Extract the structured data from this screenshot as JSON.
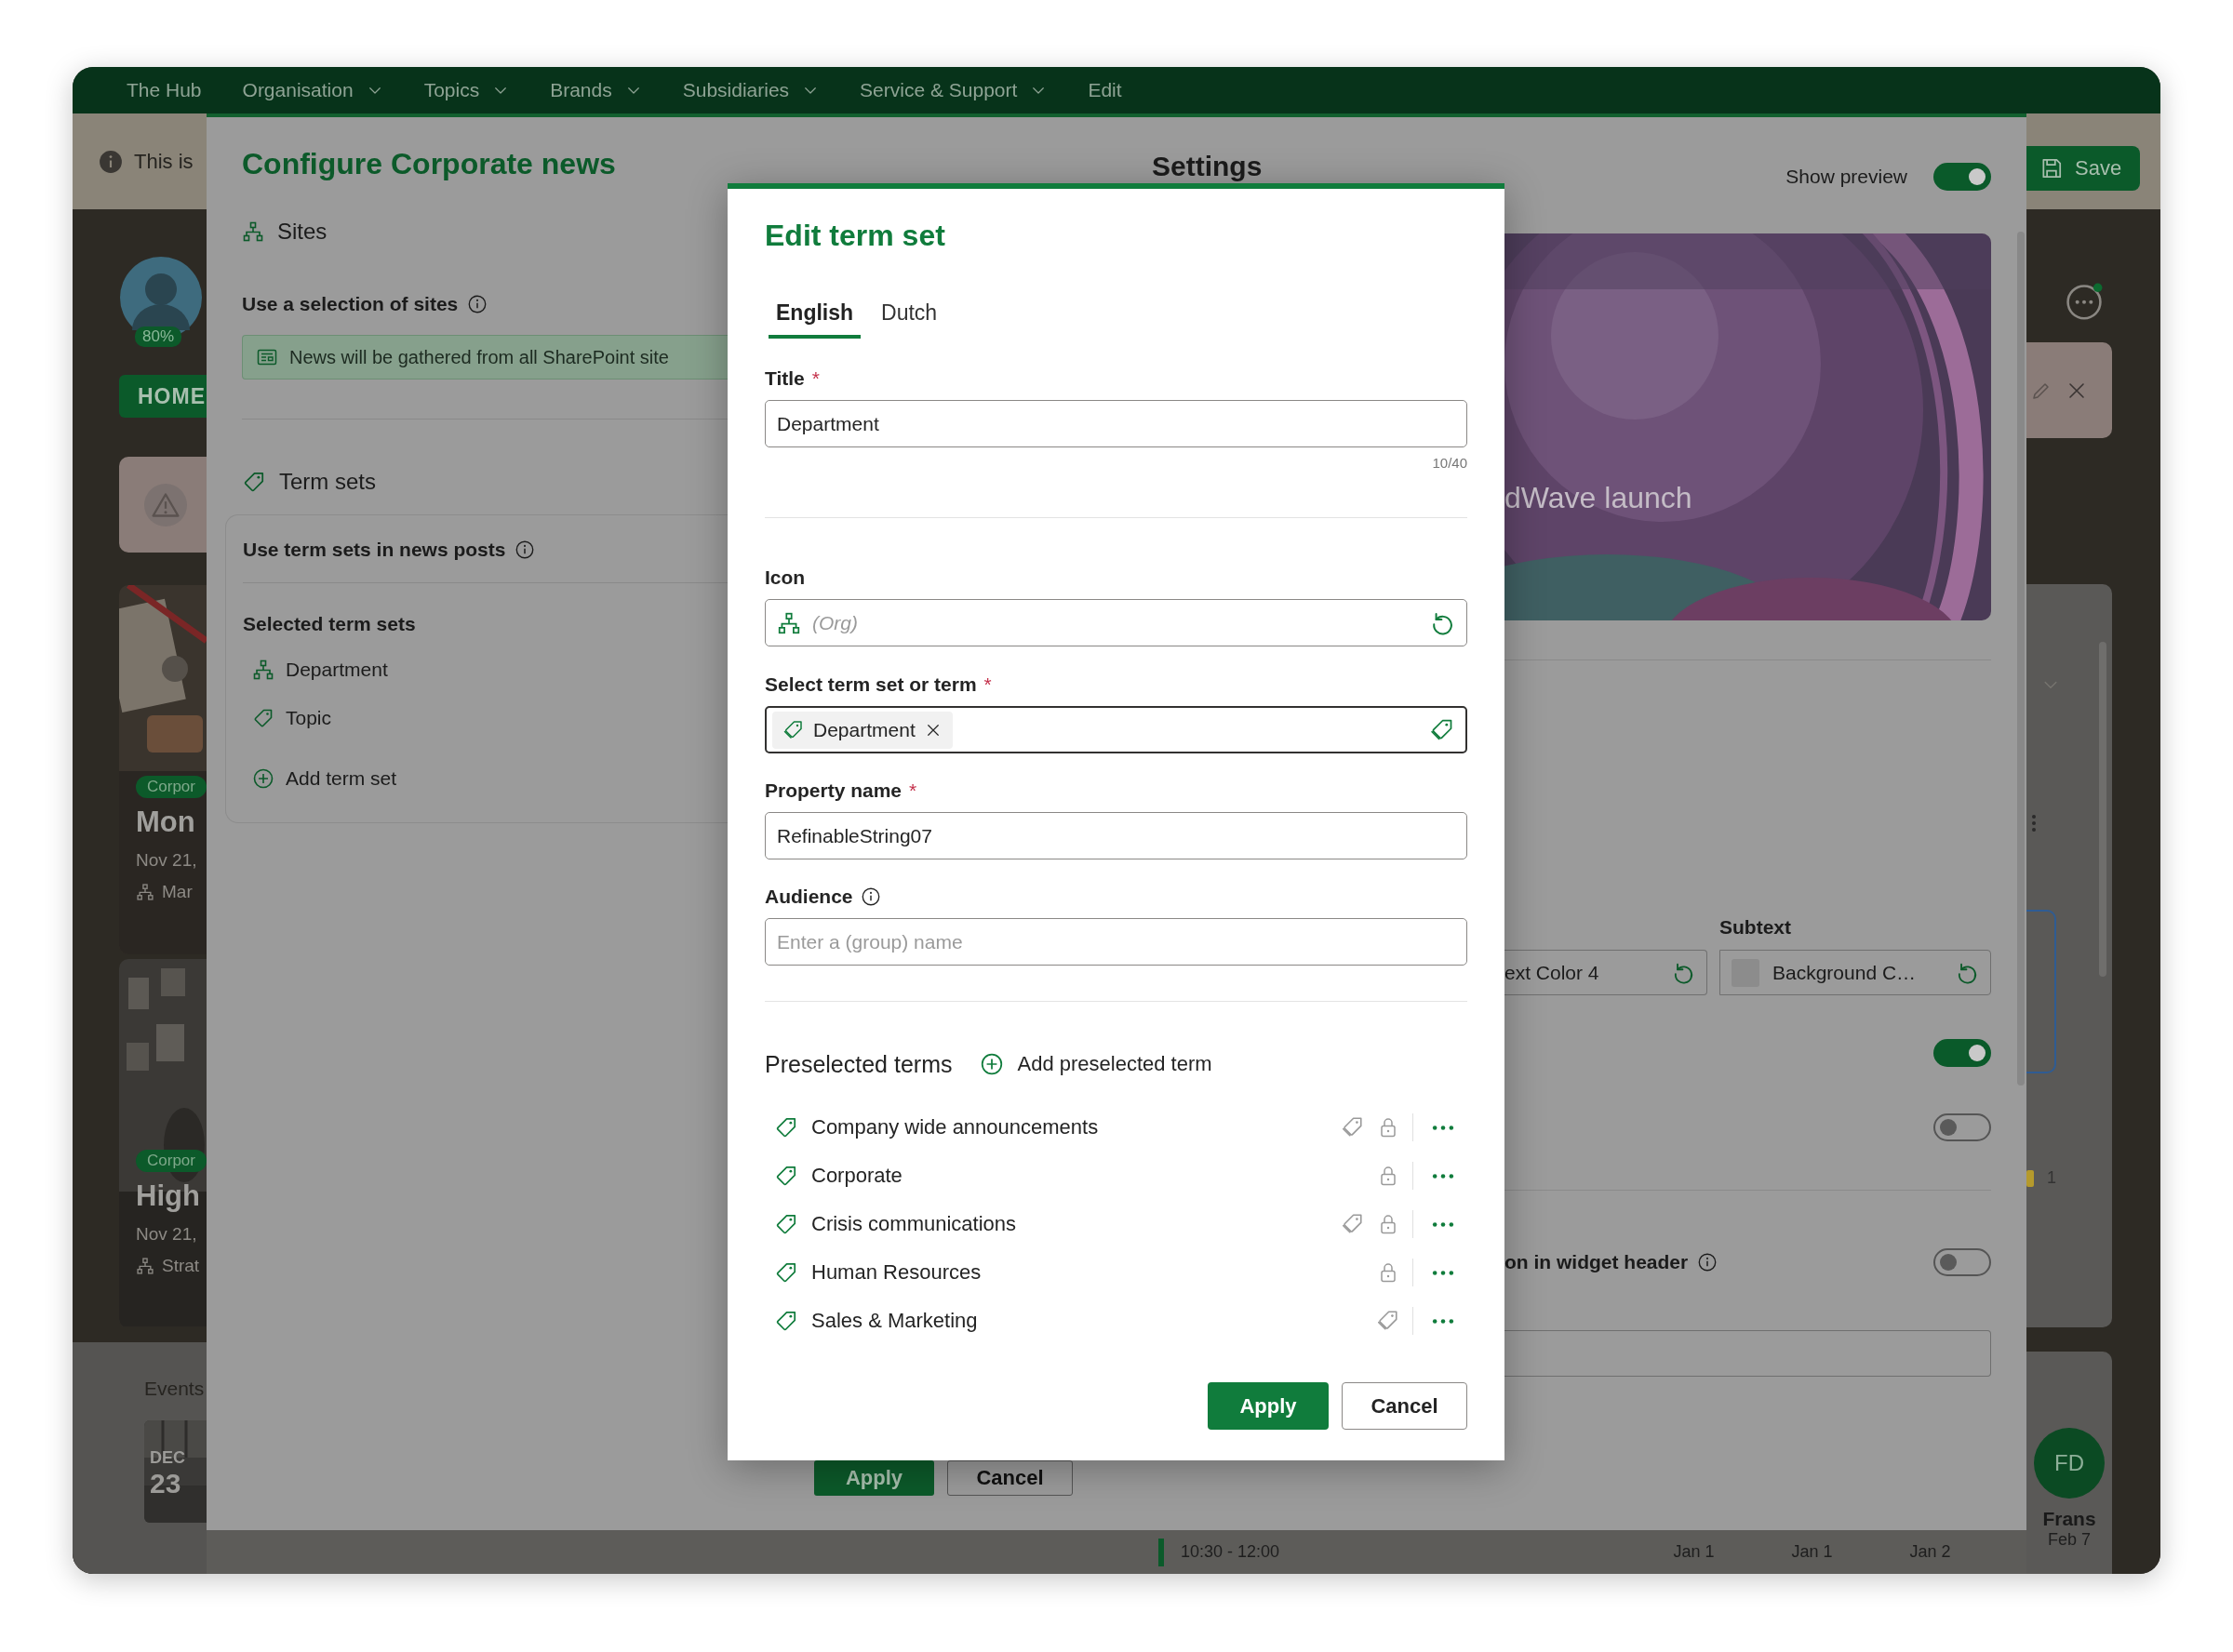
{
  "nav": {
    "items": [
      {
        "label": "The Hub",
        "dropdown": false
      },
      {
        "label": "Organisation",
        "dropdown": true
      },
      {
        "label": "Topics",
        "dropdown": true
      },
      {
        "label": "Brands",
        "dropdown": true
      },
      {
        "label": "Subsidiaries",
        "dropdown": true
      },
      {
        "label": "Service & Support",
        "dropdown": true
      },
      {
        "label": "Edit",
        "dropdown": false
      }
    ]
  },
  "page": {
    "notice": "This is",
    "profile_badge": "80%",
    "home_button": "HOME",
    "news_cards": [
      {
        "tag": "Corpor",
        "title": "Mon",
        "date": "Nov 21,",
        "site": "Mar"
      },
      {
        "tag": "Corpor",
        "title": "High",
        "date": "Nov 21,",
        "site": "Strat"
      }
    ],
    "events": {
      "title": "Events",
      "month": "DEC",
      "day": "23"
    },
    "save_button": "Save",
    "count": "1",
    "schedule": {
      "time": "10:30 - 12:00",
      "dates": [
        "Jan 1",
        "Jan 1",
        "Jan 2"
      ]
    },
    "person": {
      "initials": "FD",
      "name": "Frans",
      "date": "Feb 7"
    }
  },
  "configure_panel": {
    "title": "Configure Corporate news",
    "sites": {
      "heading": "Sites",
      "option": "Use a selection of sites",
      "message": "News will be gathered from all SharePoint site"
    },
    "term_sets": {
      "heading": "Term sets",
      "option": "Use term sets in news posts",
      "list_heading": "Selected term sets",
      "items": [
        {
          "label": "Department",
          "kind": "hierarchy"
        },
        {
          "label": "Topic",
          "kind": "tag"
        }
      ],
      "add": "Add term set"
    },
    "buttons": [
      {
        "label": "Apply",
        "kind": "primary"
      },
      {
        "label": "Cancel",
        "kind": "secondary"
      }
    ]
  },
  "settings": {
    "title": "Settings",
    "show_preview": {
      "label": "Show preview",
      "on": true
    },
    "preview_caption": "dWave launch",
    "subtext_label": "Subtext",
    "color_fields": [
      {
        "value": "ext Color 4",
        "swatch": false
      },
      {
        "value": "Background C…",
        "swatch": true
      }
    ],
    "toggles": [
      {
        "on": true
      },
      {
        "on": false
      }
    ],
    "header_option": {
      "label": "on in widget header",
      "on": false
    }
  },
  "dialog": {
    "title": "Edit term set",
    "tabs": [
      {
        "label": "English",
        "selected": true
      },
      {
        "label": "Dutch",
        "selected": false
      }
    ],
    "title_field": {
      "label": "Title",
      "required_mark": "*",
      "value": "Department",
      "counter": "10/40"
    },
    "icon_field": {
      "label": "Icon",
      "placeholder": "(Org)"
    },
    "term_field": {
      "label": "Select term set or term",
      "required_mark": "*",
      "chips": [
        "Department"
      ]
    },
    "property_field": {
      "label": "Property name",
      "required_mark": "*",
      "value": "RefinableString07"
    },
    "audience_field": {
      "label": "Audience",
      "placeholder": "Enter a (group) name"
    },
    "preselected": {
      "heading": "Preselected terms",
      "add": "Add preselected term",
      "terms": [
        {
          "label": "Company wide announcements",
          "tagged": true,
          "locked": true
        },
        {
          "label": "Corporate",
          "tagged": false,
          "locked": true
        },
        {
          "label": "Crisis communications",
          "tagged": true,
          "locked": true
        },
        {
          "label": "Human Resources",
          "tagged": false,
          "locked": true
        },
        {
          "label": "Sales & Marketing",
          "tagged": true,
          "locked": false
        }
      ]
    },
    "buttons": [
      {
        "label": "Apply",
        "kind": "primary"
      },
      {
        "label": "Cancel",
        "kind": "secondary"
      }
    ]
  }
}
